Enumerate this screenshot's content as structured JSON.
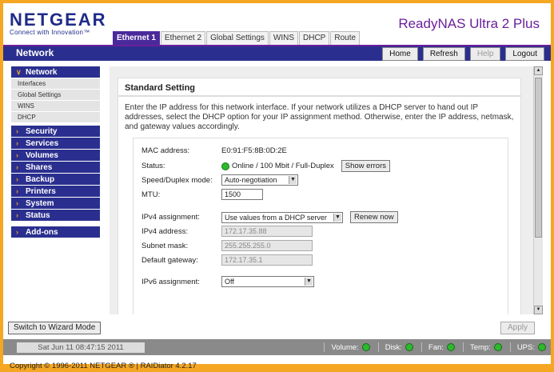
{
  "header": {
    "logo": "NETGEAR",
    "logo_tagline": "Connect with Innovation™",
    "product": "ReadyNAS Ultra 2 Plus"
  },
  "tabs": [
    {
      "label": "Ethernet 1",
      "active": true
    },
    {
      "label": "Ethernet 2"
    },
    {
      "label": "Global Settings"
    },
    {
      "label": "WINS"
    },
    {
      "label": "DHCP"
    },
    {
      "label": "Route"
    }
  ],
  "topbar": {
    "title": "Network",
    "home": "Home",
    "refresh": "Refresh",
    "help": "Help",
    "logout": "Logout"
  },
  "sidebar": {
    "network": "Network",
    "network_items": [
      "Interfaces",
      "Global Settings",
      "WINS",
      "DHCP"
    ],
    "groups": [
      "Security",
      "Services",
      "Volumes",
      "Shares",
      "Backup",
      "Printers",
      "System",
      "Status"
    ],
    "addons": "Add-ons"
  },
  "panel": {
    "title": "Standard Setting",
    "description": "Enter the IP address for this network interface. If your network utilizes a DHCP server to hand out IP addresses, select the DHCP option for your IP assignment method. Otherwise, enter the IP address, netmask, and gateway values accordingly."
  },
  "form": {
    "mac_label": "MAC address:",
    "mac_value": "E0:91:F5:8B:0D:2E",
    "status_label": "Status:",
    "status_value": "Online / 100 Mbit / Full-Duplex",
    "show_errors": "Show errors",
    "speed_label": "Speed/Duplex mode:",
    "speed_value": "Auto-negotiation",
    "mtu_label": "MTU:",
    "mtu_value": "1500",
    "ipv4_assign_label": "IPv4 assignment:",
    "ipv4_assign_value": "Use values from a DHCP server",
    "renew": "Renew now",
    "ipv4_addr_label": "IPv4 address:",
    "ipv4_addr_value": "172.17.35.88",
    "subnet_label": "Subnet mask:",
    "subnet_value": "255.255.255.0",
    "gateway_label": "Default gateway:",
    "gateway_value": "172.17.35.1",
    "ipv6_label": "IPv6 assignment:",
    "ipv6_value": "Off"
  },
  "footer": {
    "wizard": "Switch to Wizard Mode",
    "apply": "Apply",
    "datetime": "Sat Jun 11  08:47:15 2011",
    "indicators": [
      "Volume:",
      "Disk:",
      "Fan:",
      "Temp:",
      "UPS:"
    ],
    "copyright": "Copyright © 1996-2011 NETGEAR ® | RAIDiator 4.2.17"
  },
  "colors": {
    "accent": "#2a2f8f",
    "frame": "#f5a623",
    "product": "#6a1f9c",
    "ok": "#2db82d"
  }
}
